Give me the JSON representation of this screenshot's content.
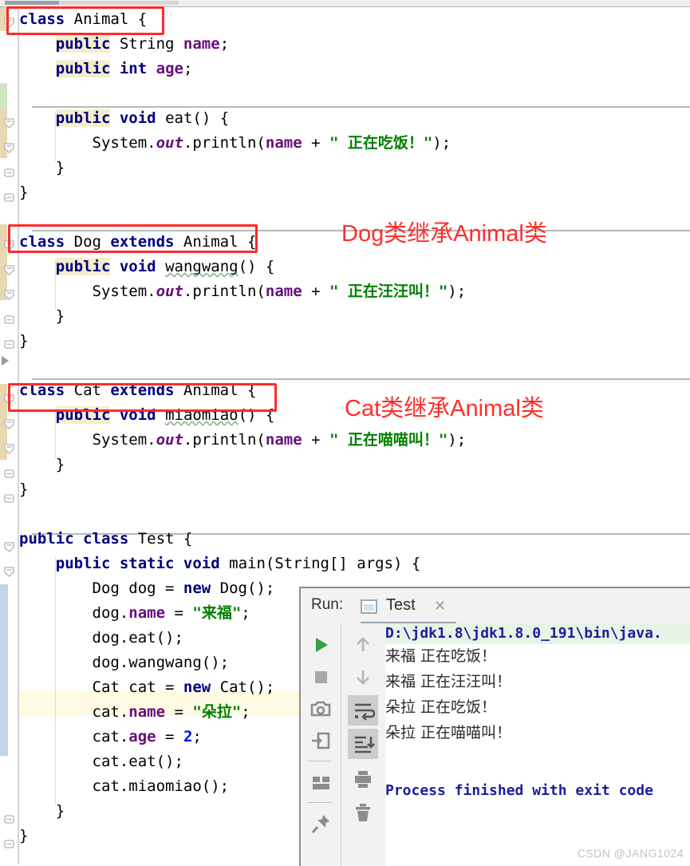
{
  "editor": {
    "lines": [
      {
        "id": "l1",
        "indent": 0,
        "segs": [
          {
            "t": "class ",
            "c": "kw"
          },
          {
            "t": "Animal {",
            "c": "plain"
          }
        ]
      },
      {
        "id": "l2",
        "indent": 1,
        "segs": [
          {
            "t": "public",
            "c": "kw hl"
          },
          {
            "t": " String ",
            "c": "plain"
          },
          {
            "t": "name",
            "c": "fld"
          },
          {
            "t": ";",
            "c": "plain"
          }
        ]
      },
      {
        "id": "l3",
        "indent": 1,
        "segs": [
          {
            "t": "public",
            "c": "kw hl"
          },
          {
            "t": " ",
            "c": "plain"
          },
          {
            "t": "int",
            "c": "kw"
          },
          {
            "t": " ",
            "c": "plain"
          },
          {
            "t": "age",
            "c": "fld"
          },
          {
            "t": ";",
            "c": "plain"
          }
        ]
      },
      {
        "id": "l4",
        "indent": 0,
        "segs": []
      },
      {
        "id": "l5",
        "indent": 1,
        "segs": [
          {
            "t": "public",
            "c": "kw hl"
          },
          {
            "t": " ",
            "c": "plain"
          },
          {
            "t": "void",
            "c": "kw"
          },
          {
            "t": " eat() {",
            "c": "plain"
          }
        ]
      },
      {
        "id": "l6",
        "indent": 2,
        "segs": [
          {
            "t": "System.",
            "c": "plain"
          },
          {
            "t": "out",
            "c": "stat"
          },
          {
            "t": ".println(",
            "c": "plain"
          },
          {
            "t": "name",
            "c": "fld"
          },
          {
            "t": " + ",
            "c": "plain"
          },
          {
            "t": "\" 正在吃饭！\"",
            "c": "str"
          },
          {
            "t": ");",
            "c": "plain"
          }
        ]
      },
      {
        "id": "l7",
        "indent": 1,
        "segs": [
          {
            "t": "}",
            "c": "plain"
          }
        ]
      },
      {
        "id": "l8",
        "indent": 0,
        "segs": [
          {
            "t": "}",
            "c": "plain"
          }
        ]
      },
      {
        "id": "l9",
        "indent": 0,
        "segs": []
      },
      {
        "id": "l10",
        "indent": 0,
        "segs": [
          {
            "t": "class ",
            "c": "kw"
          },
          {
            "t": "Dog ",
            "c": "plain"
          },
          {
            "t": "extends ",
            "c": "kw"
          },
          {
            "t": "Animal {",
            "c": "plain"
          }
        ]
      },
      {
        "id": "l11",
        "indent": 1,
        "segs": [
          {
            "t": "public",
            "c": "kw hl"
          },
          {
            "t": " ",
            "c": "plain"
          },
          {
            "t": "void",
            "c": "kw"
          },
          {
            "t": " ",
            "c": "plain"
          },
          {
            "t": "wangwang",
            "c": "plain squig"
          },
          {
            "t": "() {",
            "c": "plain"
          }
        ]
      },
      {
        "id": "l12",
        "indent": 2,
        "segs": [
          {
            "t": "System.",
            "c": "plain"
          },
          {
            "t": "out",
            "c": "stat"
          },
          {
            "t": ".println(",
            "c": "plain"
          },
          {
            "t": "name",
            "c": "fld"
          },
          {
            "t": " + ",
            "c": "plain"
          },
          {
            "t": "\" 正在汪汪叫！\"",
            "c": "str"
          },
          {
            "t": ");",
            "c": "plain"
          }
        ]
      },
      {
        "id": "l13",
        "indent": 1,
        "segs": [
          {
            "t": "}",
            "c": "plain"
          }
        ]
      },
      {
        "id": "l14",
        "indent": 0,
        "segs": [
          {
            "t": "}",
            "c": "plain"
          }
        ]
      },
      {
        "id": "l15",
        "indent": 0,
        "segs": []
      },
      {
        "id": "l16",
        "indent": 0,
        "segs": [
          {
            "t": "class ",
            "c": "kw"
          },
          {
            "t": "Cat ",
            "c": "plain"
          },
          {
            "t": "extends ",
            "c": "kw"
          },
          {
            "t": "Animal {",
            "c": "plain"
          }
        ]
      },
      {
        "id": "l17",
        "indent": 1,
        "segs": [
          {
            "t": "public",
            "c": "kw hl"
          },
          {
            "t": " ",
            "c": "plain"
          },
          {
            "t": "void",
            "c": "kw"
          },
          {
            "t": " ",
            "c": "plain"
          },
          {
            "t": "miaomiao",
            "c": "plain squig"
          },
          {
            "t": "() {",
            "c": "plain"
          }
        ]
      },
      {
        "id": "l18",
        "indent": 2,
        "segs": [
          {
            "t": "System.",
            "c": "plain"
          },
          {
            "t": "out",
            "c": "stat"
          },
          {
            "t": ".println(",
            "c": "plain"
          },
          {
            "t": "name",
            "c": "fld"
          },
          {
            "t": " + ",
            "c": "plain"
          },
          {
            "t": "\" 正在喵喵叫！\"",
            "c": "str"
          },
          {
            "t": ");",
            "c": "plain"
          }
        ]
      },
      {
        "id": "l19",
        "indent": 1,
        "segs": [
          {
            "t": "}",
            "c": "plain"
          }
        ]
      },
      {
        "id": "l20",
        "indent": 0,
        "segs": [
          {
            "t": "}",
            "c": "plain"
          }
        ]
      },
      {
        "id": "l21",
        "indent": 0,
        "segs": []
      },
      {
        "id": "l22",
        "indent": 0,
        "segs": [
          {
            "t": "public ",
            "c": "kw"
          },
          {
            "t": "class ",
            "c": "kw"
          },
          {
            "t": "Test {",
            "c": "plain"
          }
        ]
      },
      {
        "id": "l23",
        "indent": 1,
        "segs": [
          {
            "t": "public ",
            "c": "kw"
          },
          {
            "t": "static ",
            "c": "kw"
          },
          {
            "t": "void",
            "c": "kw"
          },
          {
            "t": " main(String[] args) {",
            "c": "plain"
          }
        ]
      },
      {
        "id": "l24",
        "indent": 2,
        "segs": [
          {
            "t": "Dog dog = ",
            "c": "plain"
          },
          {
            "t": "new",
            "c": "kw"
          },
          {
            "t": " Dog();",
            "c": "plain"
          }
        ]
      },
      {
        "id": "l25",
        "indent": 2,
        "segs": [
          {
            "t": "dog.",
            "c": "plain"
          },
          {
            "t": "name",
            "c": "fld"
          },
          {
            "t": " = ",
            "c": "plain"
          },
          {
            "t": "\"来福\"",
            "c": "str"
          },
          {
            "t": ";",
            "c": "plain"
          }
        ]
      },
      {
        "id": "l26",
        "indent": 2,
        "segs": [
          {
            "t": "dog.eat();",
            "c": "plain"
          }
        ]
      },
      {
        "id": "l27",
        "indent": 2,
        "segs": [
          {
            "t": "dog.wangwang();",
            "c": "plain"
          }
        ]
      },
      {
        "id": "l28",
        "indent": 2,
        "segs": [
          {
            "t": "Cat cat = ",
            "c": "plain"
          },
          {
            "t": "new",
            "c": "kw"
          },
          {
            "t": " Cat();",
            "c": "plain"
          }
        ]
      },
      {
        "id": "l29",
        "indent": 2,
        "segs": [
          {
            "t": "cat.",
            "c": "plain"
          },
          {
            "t": "name",
            "c": "fld"
          },
          {
            "t": " = ",
            "c": "plain"
          },
          {
            "t": "\"朵拉\"",
            "c": "str"
          },
          {
            "t": ";",
            "c": "plain"
          }
        ]
      },
      {
        "id": "l30",
        "indent": 2,
        "segs": [
          {
            "t": "cat.",
            "c": "plain"
          },
          {
            "t": "age",
            "c": "fld"
          },
          {
            "t": " = ",
            "c": "plain"
          },
          {
            "t": "2",
            "c": "num"
          },
          {
            "t": ";",
            "c": "plain"
          }
        ]
      },
      {
        "id": "l31",
        "indent": 2,
        "segs": [
          {
            "t": "cat.eat();",
            "c": "plain"
          }
        ]
      },
      {
        "id": "l32",
        "indent": 2,
        "segs": [
          {
            "t": "cat.miaomiao();",
            "c": "plain"
          }
        ]
      },
      {
        "id": "l33",
        "indent": 1,
        "segs": [
          {
            "t": "}",
            "c": "plain"
          }
        ]
      },
      {
        "id": "l34",
        "indent": 0,
        "segs": [
          {
            "t": "}",
            "c": "plain"
          }
        ]
      }
    ],
    "current_line_index": 27,
    "colors": {
      "keyword": "#000080",
      "field": "#660e7a",
      "string": "#008000",
      "number": "#0000ff",
      "highlight_bg": "#f5eecd",
      "current_line_bg": "#fffae3",
      "change_added": "#cfe7c4",
      "change_modified": "#e8d7b0"
    }
  },
  "annotations": {
    "boxes": [
      {
        "name": "box-animal-class"
      },
      {
        "name": "box-dog-class"
      },
      {
        "name": "box-cat-class"
      }
    ],
    "labels": [
      {
        "text": "Dog类继承Animal类"
      },
      {
        "text": "Cat类继承Animal类"
      }
    ],
    "color": "#ff2d2d"
  },
  "run_panel": {
    "label": "Run:",
    "tab_name": "Test",
    "tab_close": "✕",
    "toolbar_left": [
      {
        "name": "run-button",
        "glyph": "play"
      },
      {
        "name": "stop-button",
        "glyph": "stop"
      },
      {
        "name": "screenshot-button",
        "glyph": "camera"
      },
      {
        "name": "export-button",
        "glyph": "export"
      },
      {
        "name": "layout-button",
        "glyph": "layout"
      },
      {
        "name": "pin-button",
        "glyph": "pin"
      }
    ],
    "toolbar_right": [
      {
        "name": "up-arrow-button",
        "glyph": "up",
        "selected": false
      },
      {
        "name": "down-arrow-button",
        "glyph": "down",
        "selected": false
      },
      {
        "name": "soft-wrap-button",
        "glyph": "wrap",
        "selected": true
      },
      {
        "name": "scroll-to-end-button",
        "glyph": "scroll-end",
        "selected": true
      },
      {
        "name": "print-button",
        "glyph": "print",
        "selected": false
      },
      {
        "name": "clear-all-button",
        "glyph": "trash",
        "selected": false
      }
    ],
    "console": {
      "command": "D:\\jdk1.8\\jdk1.8.0_191\\bin\\java.",
      "output": [
        "来福 正在吃饭！",
        "来福 正在汪汪叫！",
        "朵拉 正在吃饭！",
        "朵拉 正在喵喵叫！"
      ],
      "exit": "Process finished with exit code"
    }
  },
  "watermark": "CSDN @JANG1024"
}
